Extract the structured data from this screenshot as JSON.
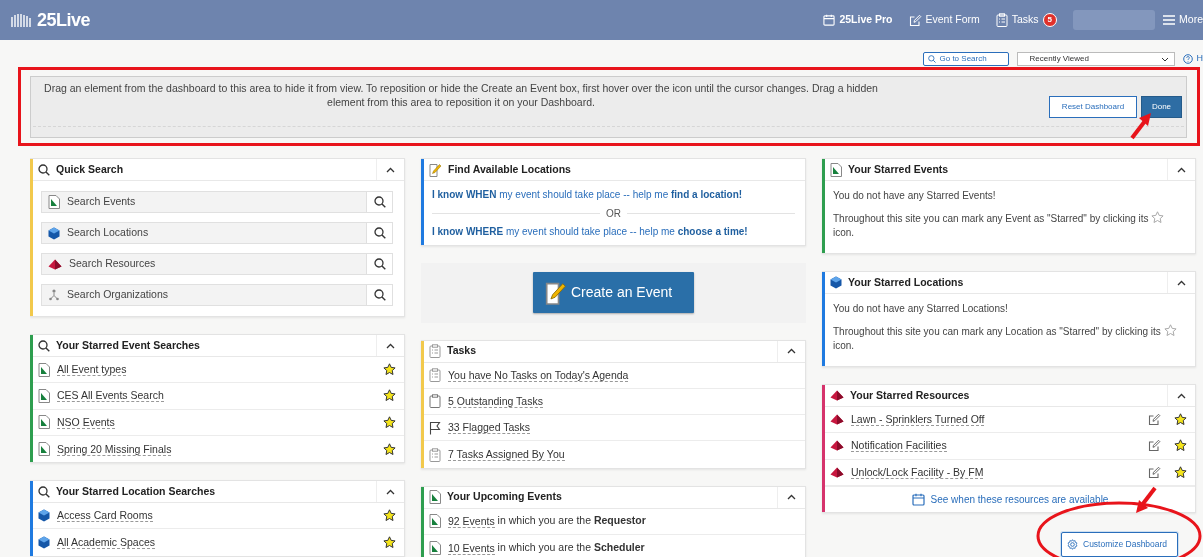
{
  "navbar": {
    "logo": "25Live",
    "links": [
      {
        "label": "25Live Pro"
      },
      {
        "label": "Event Form"
      },
      {
        "label": "Tasks",
        "badge": "5"
      }
    ],
    "menu": "More"
  },
  "toolbar": {
    "search_button": "Go to Search",
    "recent": "Recently Viewed",
    "help": "H"
  },
  "drop_zone": {
    "message": "Drag an element from the dashboard to this area to hide it from view.  To reposition or hide the Create an Event box, first hover over the icon until the cursor changes.  Drag a hidden element from this area to reposition it on your Dashboard.",
    "buttons": [
      {
        "label": "Reset Dashboard",
        "kind": "outline"
      },
      {
        "label": "Done",
        "kind": "primary"
      }
    ]
  },
  "columns": [
    [
      {
        "kind": "quick_search",
        "title": "Quick Search",
        "color": "#f2c94c",
        "collapsible": true,
        "items": [
          {
            "kind": "event",
            "label": "Search Events"
          },
          {
            "kind": "location",
            "label": "Search Locations"
          },
          {
            "kind": "resource",
            "label": "Search Resources"
          },
          {
            "kind": "organization",
            "label": "Search Organizations"
          }
        ]
      },
      {
        "kind": "list",
        "title": "Your Starred Event Searches",
        "color": "#2e9e4f",
        "collapsible": true,
        "items": [
          {
            "kind": "event",
            "label": "All Event types",
            "starred": true
          },
          {
            "kind": "event",
            "label": "CES All Events Search",
            "starred": true
          },
          {
            "kind": "event",
            "label": "NSO Events",
            "starred": true
          },
          {
            "kind": "event",
            "label": "Spring 20 Missing Finals",
            "starred": true
          }
        ]
      },
      {
        "kind": "list",
        "title": "Your Starred Location Searches",
        "color": "#1f7ae0",
        "collapsible": true,
        "items": [
          {
            "kind": "location",
            "label": "Access Card Rooms",
            "starred": true
          },
          {
            "kind": "location",
            "label": "All Academic Spaces",
            "starred": true
          }
        ]
      }
    ],
    [
      {
        "kind": "find",
        "title": "Find Available Locations",
        "color": "#1f7ae0",
        "collapsible": false,
        "lines": [
          "**I know WHEN** my event should take place -- help me **find a location!**",
          "**I know WHERE** my event should take place -- help me **choose a time!**"
        ],
        "separator": "OR"
      },
      {
        "kind": "create",
        "button": "Create an Event"
      },
      {
        "kind": "list",
        "title": "Tasks",
        "color": "#f2c94c",
        "collapsible": true,
        "items": [
          {
            "kind": "clipboard",
            "label": "You have No Tasks on Today's Agenda"
          },
          {
            "kind": "square",
            "label": "5 Outstanding Tasks"
          },
          {
            "kind": "flag",
            "label": "33 Flagged Tasks"
          },
          {
            "kind": "clipboard",
            "label": "7 Tasks Assigned By You"
          }
        ]
      },
      {
        "kind": "list",
        "title": "Your Upcoming Events",
        "color": "#2e9e4f",
        "collapsible": true,
        "items": [
          {
            "kind": "event",
            "label": "92 Events",
            "suffix": " in which you are the **Requestor**"
          },
          {
            "kind": "event",
            "label": "10 Events",
            "suffix": " in which you are the **Scheduler**"
          }
        ]
      }
    ],
    [
      {
        "kind": "message",
        "title": "Your Starred Events",
        "color": "#2e9e4f",
        "collapsible": true,
        "message": "You do not have any Starred Events!",
        "hint_before": "Throughout this site you can mark any Event as \"Starred\" by clicking its",
        "hint_after": "icon."
      },
      {
        "kind": "message",
        "title": "Your Starred Locations",
        "color": "#1f7ae0",
        "collapsible": true,
        "message": "You do not have any Starred Locations!",
        "hint_before": "Throughout this site you can mark any Location as \"Starred\" by clicking its",
        "hint_after": "icon."
      },
      {
        "kind": "list",
        "title": "Your Starred Resources",
        "color": "#d6336c",
        "collapsible": true,
        "items": [
          {
            "kind": "resource",
            "label": "Lawn - Sprinklers Turned Off",
            "starred": true,
            "editable": true
          },
          {
            "kind": "resource",
            "label": "Notification Facilities",
            "starred": true,
            "editable": true
          },
          {
            "kind": "resource",
            "label": "Unlock/Lock Facility - By FM",
            "starred": true,
            "editable": true
          }
        ],
        "footer": "See when these resources are available"
      },
      {
        "kind": "customize",
        "button": "Customize Dashboard"
      }
    ]
  ],
  "annotations": [
    {
      "kind": "rectangle"
    },
    {
      "kind": "arrow"
    },
    {
      "kind": "arrow"
    },
    {
      "kind": "ellipse"
    }
  ]
}
